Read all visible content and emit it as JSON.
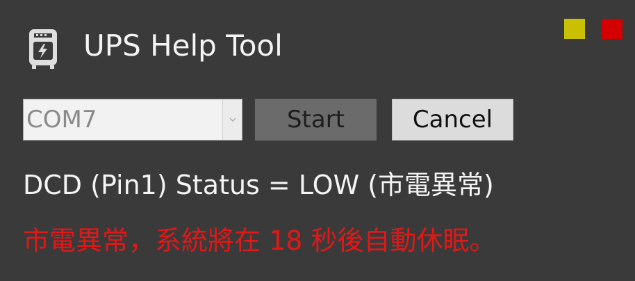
{
  "app": {
    "title": "UPS Help Tool",
    "icon": "ups-device-icon"
  },
  "window_controls": {
    "minimize_color": "#c8c000",
    "close_color": "#d40000"
  },
  "controls": {
    "port_value": "COM7",
    "start_label": "Start",
    "cancel_label": "Cancel"
  },
  "status": {
    "text": "DCD (Pin1) Status = LOW (市電異常)",
    "alert": "市電異常，系統將在 18 秒後自動休眠。",
    "alert_color": "#e01818"
  }
}
